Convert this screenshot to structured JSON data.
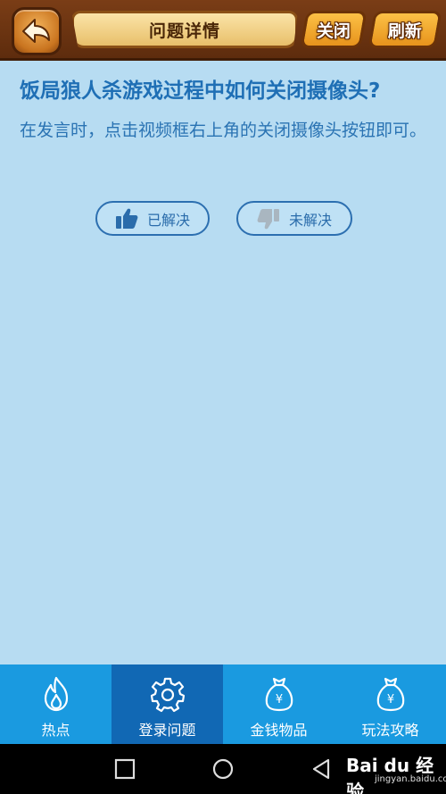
{
  "header": {
    "title": "问题详情",
    "close_label": "关闭",
    "refresh_label": "刷新"
  },
  "question": {
    "title": "饭局狼人杀游戏过程中如何关闭摄像头?",
    "answer": "在发言时，点击视频框右上角的关闭摄像头按钮即可。"
  },
  "feedback": {
    "solved_label": "已解决",
    "unsolved_label": "未解决"
  },
  "bottom_nav": {
    "items": [
      {
        "label": "热点",
        "icon": "flame-icon"
      },
      {
        "label": "登录问题",
        "icon": "gear-icon",
        "active": true
      },
      {
        "label": "金钱物品",
        "icon": "money-bag-icon"
      },
      {
        "label": "玩法攻略",
        "icon": "money-bag-icon"
      }
    ]
  },
  "watermark": {
    "brand": "Bai du 经验",
    "url": "jingyan.baidu.com"
  },
  "colors": {
    "background": "#b7dcf2",
    "accent_text": "#1f6fb5",
    "nav_bg": "#1a9ae0",
    "nav_active": "#1168b4",
    "header_wood": "#6b3210"
  }
}
